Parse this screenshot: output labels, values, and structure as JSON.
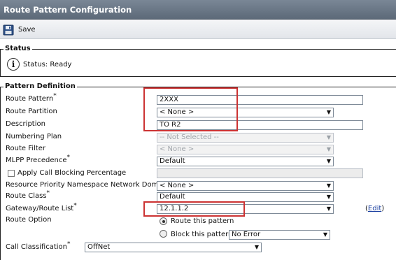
{
  "page": {
    "title": "Route Pattern Configuration"
  },
  "toolbar": {
    "save_label": "Save",
    "save_icon": "floppy-disk-icon"
  },
  "status": {
    "legend": "Status",
    "icon": "info-icon",
    "icon_glyph": "i",
    "text": "Status: Ready"
  },
  "pattern": {
    "legend": "Pattern Definition",
    "route_pattern": {
      "label": "Route Pattern",
      "required": "*",
      "value": "2XXX"
    },
    "route_partition": {
      "label": "Route Partition",
      "value": "< None >"
    },
    "description": {
      "label": "Description",
      "value": "TO R2"
    },
    "numbering_plan": {
      "label": "Numbering Plan",
      "value": "-- Not Selected --"
    },
    "route_filter": {
      "label": "Route Filter",
      "value": "< None >"
    },
    "mlpp_precedence": {
      "label": "MLPP Precedence",
      "required": "*",
      "value": "Default"
    },
    "call_blocking": {
      "label": "Apply Call Blocking Percentage",
      "value": ""
    },
    "resource_priority": {
      "label": "Resource Priority Namespace Network Domain",
      "value": "< None >"
    },
    "route_class": {
      "label": "Route Class",
      "required": "*",
      "value": "Default"
    },
    "gateway": {
      "label": "Gateway/Route List",
      "required": "*",
      "value": "12.1.1.2",
      "edit_open": "(",
      "edit_label": "Edit",
      "edit_close": ")"
    },
    "route_option": {
      "label": "Route Option",
      "route_this_pattern": "Route this pattern",
      "block_this_pattern": "Block this pattern",
      "block_reason": "No Error"
    },
    "call_classification": {
      "label": "Call Classification",
      "required": "*",
      "value": "OffNet"
    }
  },
  "colors": {
    "title_bar": "#5c6978",
    "highlight": "#cc3333",
    "link": "#1a3fa0"
  }
}
